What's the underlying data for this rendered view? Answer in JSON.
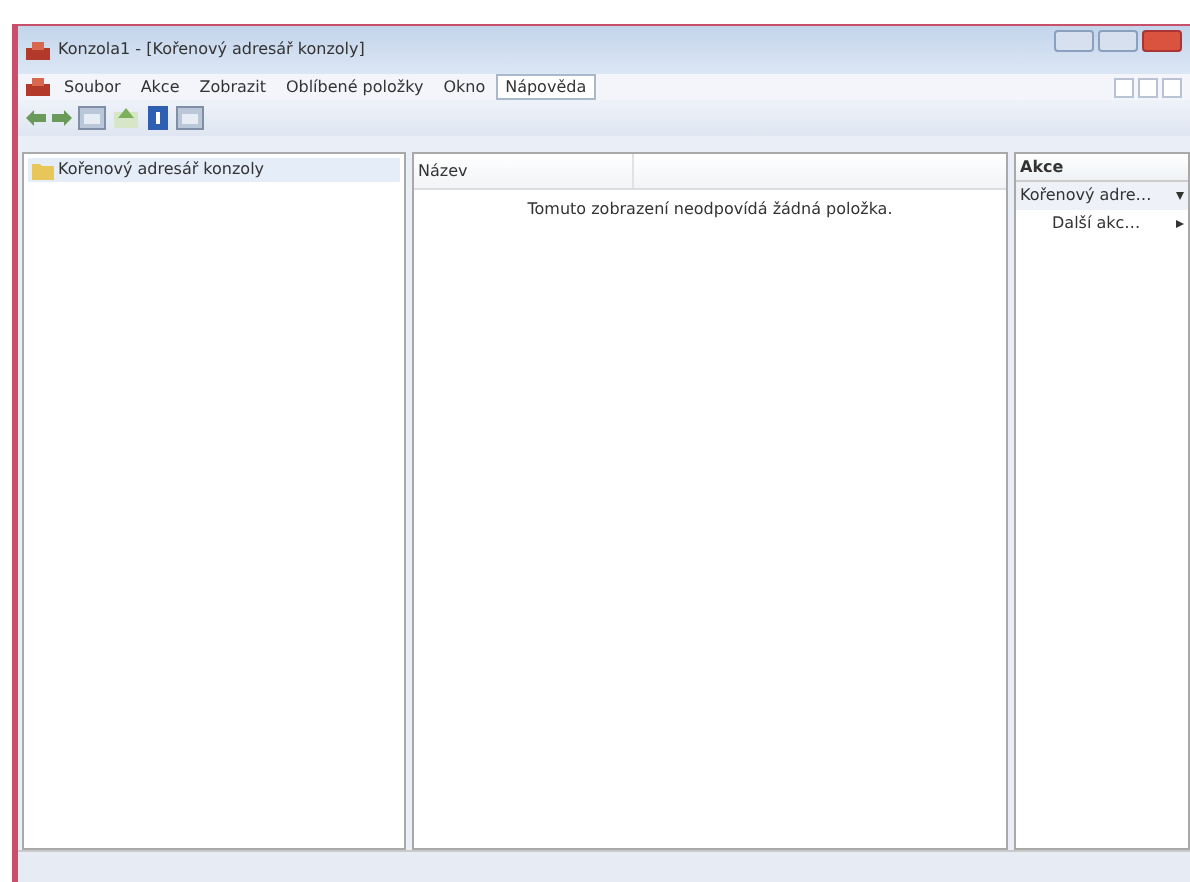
{
  "window": {
    "title": "Konzola1 - [Kořenový adresář konzoly]"
  },
  "menu": [
    {
      "label": "Soubor",
      "selected": false
    },
    {
      "label": "Akce",
      "selected": false
    },
    {
      "label": "Zobrazit",
      "selected": false
    },
    {
      "label": "Oblíbené položky",
      "selected": false
    },
    {
      "label": "Okno",
      "selected": false
    },
    {
      "label": "Nápověda",
      "selected": true
    }
  ],
  "tree": [
    {
      "label": "Kořenový adresář konzoly",
      "selected": true
    }
  ],
  "list": {
    "columns": [
      "Název"
    ],
    "empty_message": "Tomuto zobrazení neodpovídá žádná položka."
  },
  "actions": {
    "header": "Akce",
    "items": [
      {
        "label": "Kořenový adre…",
        "kind": "section"
      },
      {
        "label": "Další akc…",
        "kind": "item"
      }
    ]
  }
}
